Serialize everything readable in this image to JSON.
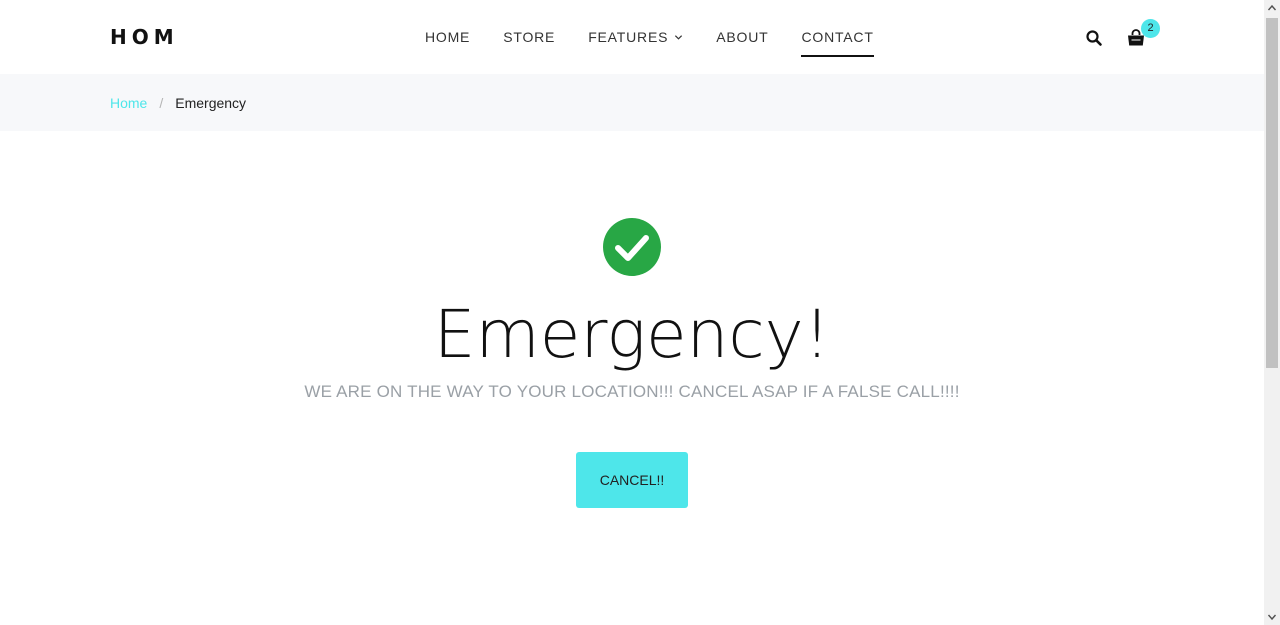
{
  "header": {
    "logo": "HOM",
    "nav": [
      {
        "label": "HOME",
        "active": false
      },
      {
        "label": "STORE",
        "active": false
      },
      {
        "label": "FEATURES",
        "active": false,
        "has_dropdown": true
      },
      {
        "label": "ABOUT",
        "active": false
      },
      {
        "label": "CONTACT",
        "active": true
      }
    ],
    "cart_count": "2",
    "icons": {
      "search": "search-icon",
      "cart": "shopping-bag-icon"
    }
  },
  "breadcrumb": {
    "home": "Home",
    "separator": "/",
    "current": "Emergency"
  },
  "main": {
    "status_icon": "check-circle-icon",
    "title": "Emergency!",
    "subtitle": "WE ARE ON THE WAY TO YOUR LOCATION!!! CANCEL ASAP IF A FALSE CALL!!!!",
    "cancel_label": "CANCEL!!"
  },
  "colors": {
    "accent": "#4ee6ea",
    "success": "#28a745",
    "breadcrumb_bg": "#f7f8fa",
    "subtitle": "#9aa0a6"
  }
}
